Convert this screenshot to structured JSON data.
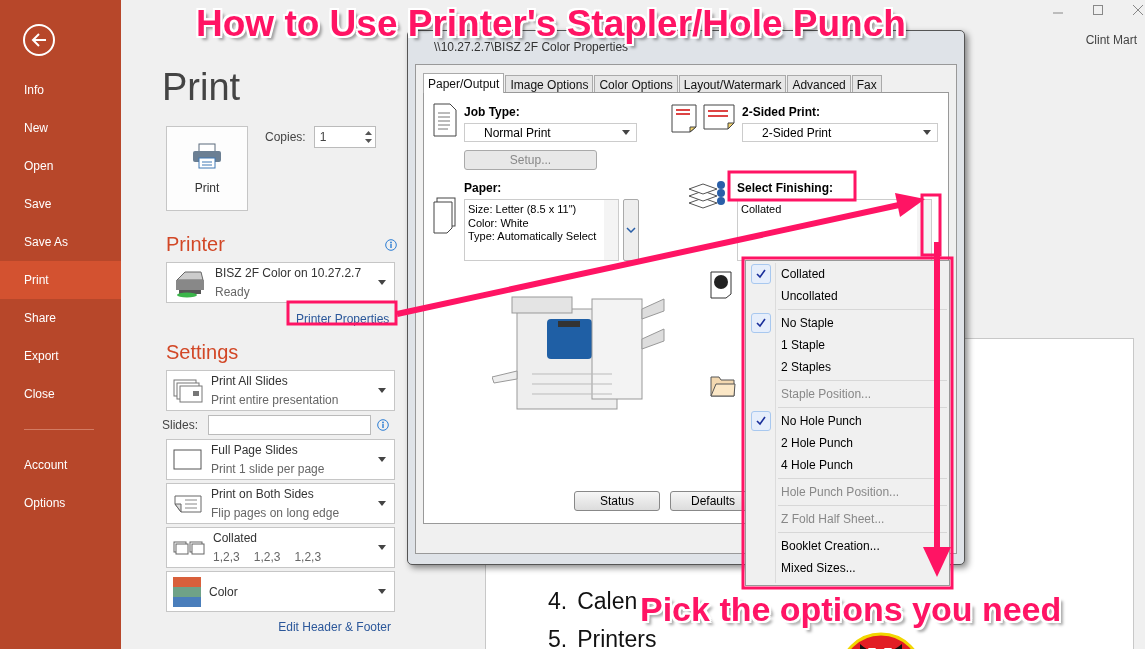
{
  "annotations": {
    "title": "How to Use Printer's Stapler/Hole Punch",
    "caption": "Pick the options you need"
  },
  "window": {
    "user": "Clint Mart"
  },
  "sidebar": {
    "items": [
      {
        "label": "Info",
        "selected": false
      },
      {
        "label": "New",
        "selected": false
      },
      {
        "label": "Open",
        "selected": false
      },
      {
        "label": "Save",
        "selected": false
      },
      {
        "label": "Save As",
        "selected": false
      },
      {
        "label": "Print",
        "selected": true
      },
      {
        "label": "Share",
        "selected": false
      },
      {
        "label": "Export",
        "selected": false
      },
      {
        "label": "Close",
        "selected": false
      }
    ],
    "bottom_items": [
      {
        "label": "Account",
        "selected": false
      },
      {
        "label": "Options",
        "selected": false
      }
    ]
  },
  "print": {
    "heading": "Print",
    "print_button": "Print",
    "copies_label": "Copies:",
    "copies": "1"
  },
  "printer": {
    "heading": "Printer",
    "name": "BISZ 2F Color on 10.27.2.7",
    "status": "Ready",
    "properties_link": "Printer Properties"
  },
  "settings": {
    "heading": "Settings",
    "options": [
      {
        "kind": "slides",
        "title": "Print All Slides",
        "subtitle": "Print entire presentation"
      },
      {
        "kind": "field",
        "label": "Slides:"
      },
      {
        "kind": "layout",
        "title": "Full Page Slides",
        "subtitle": "Print 1 slide per page"
      },
      {
        "kind": "duplex",
        "title": "Print on Both Sides",
        "subtitle": "Flip pages on long edge"
      },
      {
        "kind": "collate",
        "title": "Collated",
        "parts": [
          "1,2,3",
          "1,2,3",
          "1,2,3"
        ]
      },
      {
        "kind": "color",
        "title": "Color"
      }
    ],
    "footer_link": "Edit Header & Footer"
  },
  "dialog": {
    "title": "\\\\10.27.2.7\\BISZ 2F Color Properties",
    "tabs": [
      {
        "label": "Paper/Output",
        "selected": true
      },
      {
        "label": "Image Options",
        "selected": false
      },
      {
        "label": "Color Options",
        "selected": false
      },
      {
        "label": "Layout/Watermark",
        "selected": false
      },
      {
        "label": "Advanced",
        "selected": false
      },
      {
        "label": "Fax",
        "selected": false
      }
    ],
    "job_type": {
      "label": "Job Type:",
      "value": "Normal Print"
    },
    "setup_button": {
      "label": "Setup...",
      "disabled": true
    },
    "two_sided": {
      "label": "2-Sided Print:",
      "value": "2-Sided Print"
    },
    "paper": {
      "label": "Paper:",
      "lines": [
        "Size: Letter (8.5 x 11\")",
        "Color: White",
        "Type: Automatically Select"
      ]
    },
    "finishing": {
      "label": "Select Finishing:",
      "value": "Collated"
    },
    "buttons": [
      "Status",
      "Defaults"
    ]
  },
  "finishing_menu": {
    "items": [
      {
        "kind": "item",
        "label": "Collated",
        "checked": true,
        "disabled": false
      },
      {
        "kind": "item",
        "label": "Uncollated",
        "checked": false,
        "disabled": false
      },
      {
        "kind": "separator"
      },
      {
        "kind": "item",
        "label": "No Staple",
        "checked": true,
        "disabled": false
      },
      {
        "kind": "item",
        "label": "1 Staple",
        "checked": false,
        "disabled": false
      },
      {
        "kind": "item",
        "label": "2 Staples",
        "checked": false,
        "disabled": false
      },
      {
        "kind": "separator"
      },
      {
        "kind": "item",
        "label": "Staple Position...",
        "checked": false,
        "disabled": true
      },
      {
        "kind": "separator"
      },
      {
        "kind": "item",
        "label": "No Hole Punch",
        "checked": true,
        "disabled": false
      },
      {
        "kind": "item",
        "label": "2 Hole Punch",
        "checked": false,
        "disabled": false
      },
      {
        "kind": "item",
        "label": "4 Hole Punch",
        "checked": false,
        "disabled": false
      },
      {
        "kind": "separator"
      },
      {
        "kind": "item",
        "label": "Hole Punch Position...",
        "checked": false,
        "disabled": true
      },
      {
        "kind": "separator"
      },
      {
        "kind": "item",
        "label": "Z Fold Half Sheet...",
        "checked": false,
        "disabled": true
      },
      {
        "kind": "separator"
      },
      {
        "kind": "item",
        "label": "Booklet Creation...",
        "checked": false,
        "disabled": false
      },
      {
        "kind": "item",
        "label": "Mixed Sizes...",
        "checked": false,
        "disabled": false
      }
    ]
  },
  "slide": {
    "items": [
      {
        "number": "4.",
        "text": "Calen"
      },
      {
        "number": "5.",
        "text": "Printers"
      }
    ]
  }
}
